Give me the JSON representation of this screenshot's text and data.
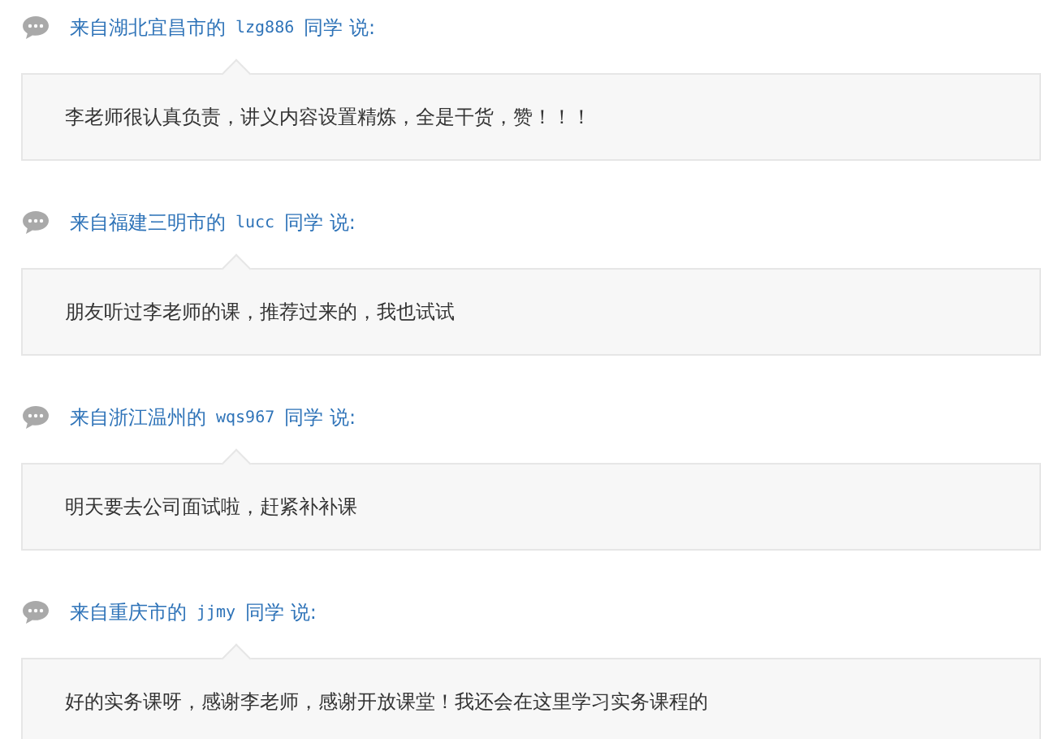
{
  "comments": [
    {
      "prefix": "来自湖北宜昌市的",
      "user": "lzg886",
      "suffix": "同学 说:",
      "text": "李老师很认真负责，讲义内容设置精炼，全是干货，赞！！！"
    },
    {
      "prefix": "来自福建三明市的",
      "user": "lucc",
      "suffix": "同学 说:",
      "text": "朋友听过李老师的课，推荐过来的，我也试试"
    },
    {
      "prefix": "来自浙江温州的",
      "user": "wqs967",
      "suffix": "同学 说:",
      "text": "明天要去公司面试啦，赶紧补补课"
    },
    {
      "prefix": "来自重庆市的",
      "user": "jjmy",
      "suffix": "同学 说:",
      "text": "好的实务课呀，感谢李老师，感谢开放课堂！我还会在这里学习实务课程的"
    }
  ]
}
